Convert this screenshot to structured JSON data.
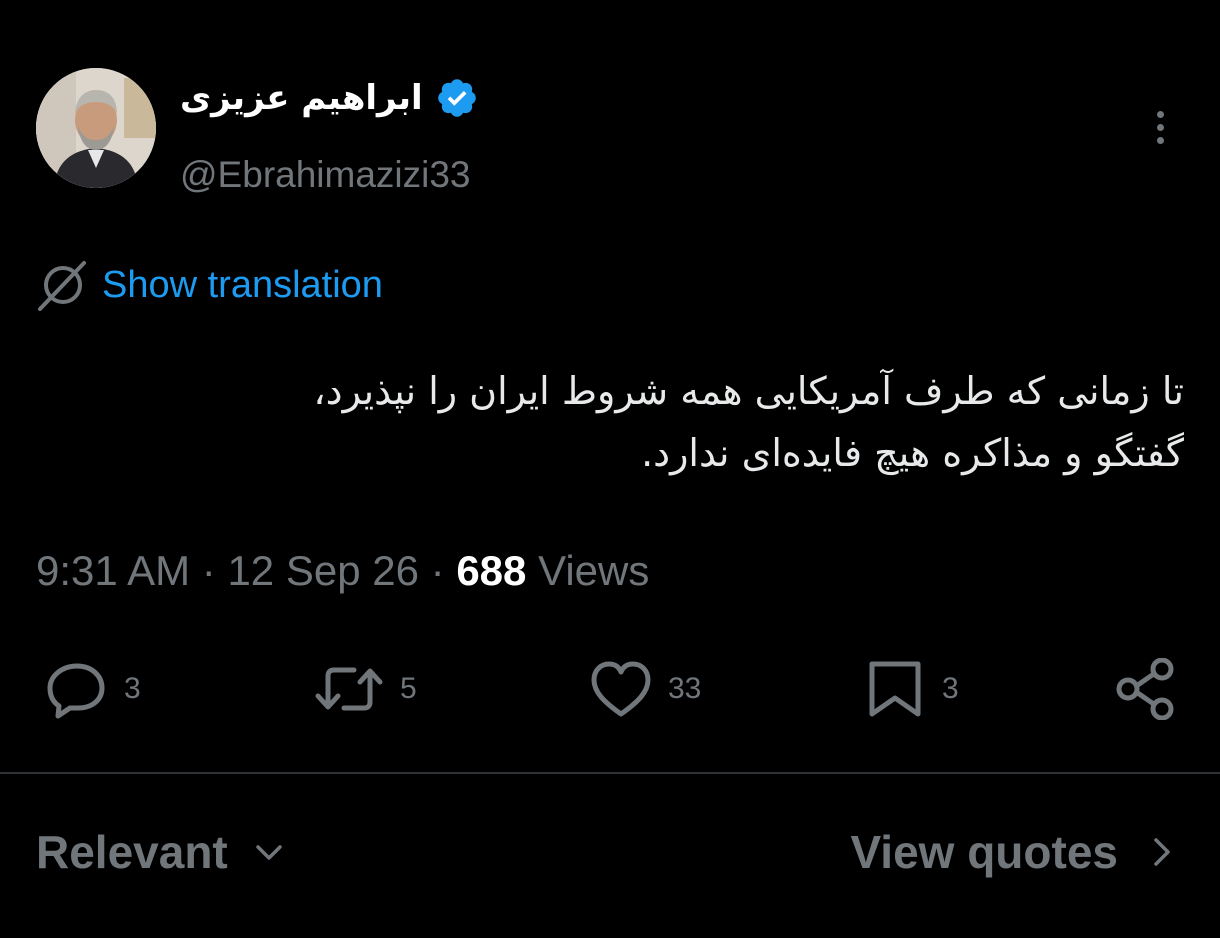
{
  "author": {
    "display_name": "ابراهیم عزیزی",
    "handle": "@Ebrahimazizi33",
    "verified": true,
    "avatar_icon": "profile-photo"
  },
  "tweet": {
    "translate_label": "Show translation",
    "text": "تا زمانی که طرف آمریکایی همه شروط ایران را نپذیرد،\nگفتگو و مذاکره هیچ فایده‌ای ندارد.",
    "time": "9:31 AM",
    "separator": "·",
    "date": "12 Sep 26",
    "views_count": "688",
    "views_label": "Views"
  },
  "actions": {
    "reply": {
      "icon": "reply-icon",
      "count": "3"
    },
    "retweet": {
      "icon": "retweet-icon",
      "count": "5"
    },
    "like": {
      "icon": "heart-icon",
      "count": "33"
    },
    "bookmark": {
      "icon": "bookmark-icon",
      "count": "3"
    },
    "share": {
      "icon": "share-icon"
    }
  },
  "replies_bar": {
    "sort_label": "Relevant",
    "quotes_label": "View quotes"
  },
  "colors": {
    "background": "#000000",
    "primary_text": "#e7e9ea",
    "secondary_text": "#71767b",
    "link": "#1d9bf0",
    "verified_badge": "#1d9bf0",
    "divider": "#2f3336"
  }
}
